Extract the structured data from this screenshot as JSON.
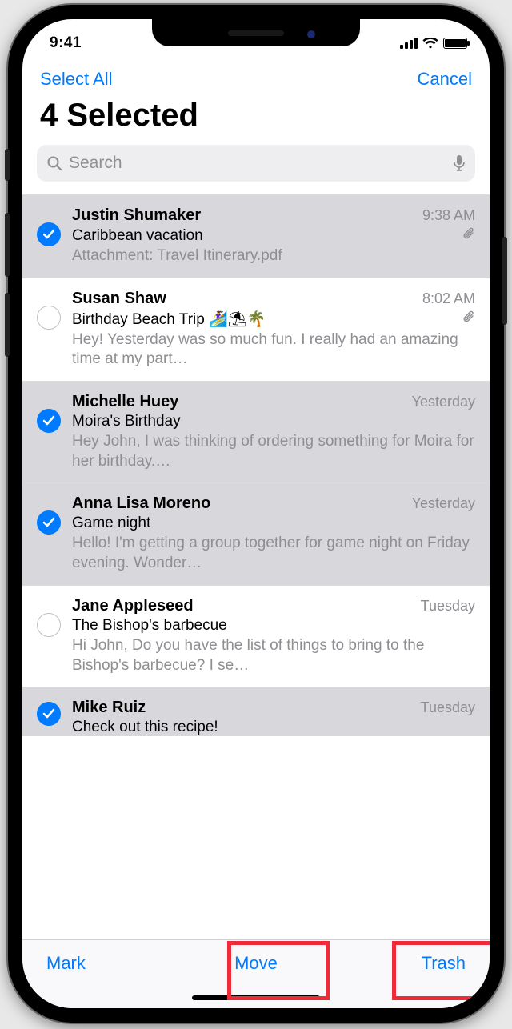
{
  "status": {
    "time": "9:41"
  },
  "nav": {
    "select_all": "Select All",
    "cancel": "Cancel"
  },
  "title": "4 Selected",
  "search": {
    "placeholder": "Search"
  },
  "toolbar": {
    "mark": "Mark",
    "move": "Move",
    "trash": "Trash"
  },
  "emails": [
    {
      "selected": true,
      "sender": "Justin Shumaker",
      "time": "9:38 AM",
      "subject": "Caribbean vacation",
      "preview": "Attachment: Travel Itinerary.pdf",
      "has_attachment": true
    },
    {
      "selected": false,
      "sender": "Susan Shaw",
      "time": "8:02 AM",
      "subject": "Birthday Beach Trip 🏄‍♀️⛱🌴",
      "preview": "Hey! Yesterday was so much fun. I really had an amazing time at my part…",
      "has_attachment": true
    },
    {
      "selected": true,
      "sender": "Michelle Huey",
      "time": "Yesterday",
      "subject": "Moira's Birthday",
      "preview": "Hey John, I was thinking of ordering something for Moira for her birthday.…",
      "has_attachment": false
    },
    {
      "selected": true,
      "sender": "Anna Lisa Moreno",
      "time": "Yesterday",
      "subject": "Game night",
      "preview": "Hello! I'm getting a group together for game night on Friday evening. Wonder…",
      "has_attachment": false
    },
    {
      "selected": false,
      "sender": "Jane Appleseed",
      "time": "Tuesday",
      "subject": "The Bishop's barbecue",
      "preview": "Hi John, Do you have the list of things to bring to the Bishop's barbecue? I se…",
      "has_attachment": false
    },
    {
      "selected": true,
      "sender": "Mike Ruiz",
      "time": "Tuesday",
      "subject": "Check out this recipe!",
      "preview": "",
      "has_attachment": false,
      "cut": true
    }
  ]
}
